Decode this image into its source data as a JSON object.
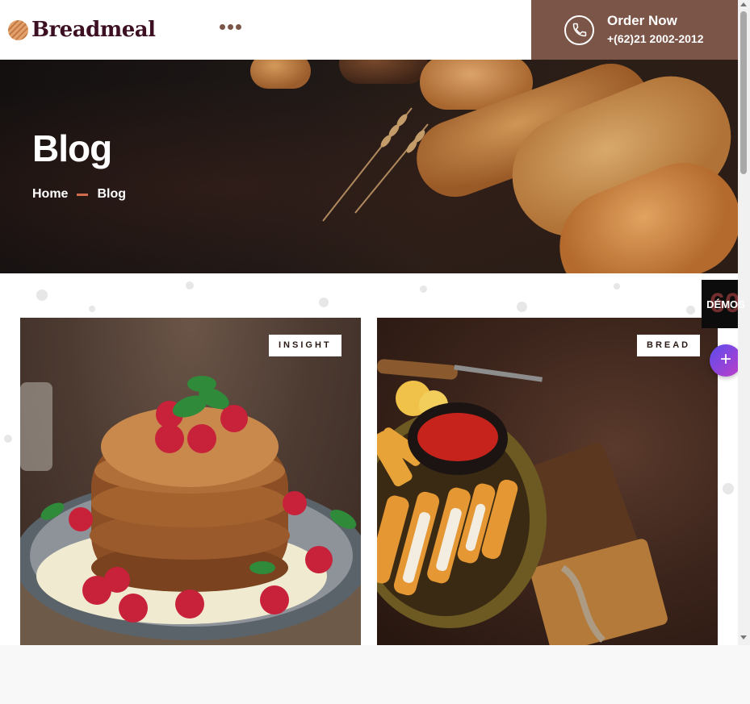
{
  "header": {
    "brand": "Breadmeal",
    "order_title": "Order Now",
    "order_phone": "+(62)21 2002-2012",
    "menu_icon": "more-dots-icon",
    "phone_icon": "phone-icon"
  },
  "hero": {
    "title": "Blog",
    "breadcrumb": [
      "Home",
      "Blog"
    ]
  },
  "posts": [
    {
      "category": "INSIGHT",
      "image": "pancakes-with-raspberries"
    },
    {
      "category": "BREAD",
      "image": "chicken-strips-with-fries"
    }
  ],
  "side": {
    "demos_label": "DÉMOS",
    "demos_ghost": "60",
    "plus_label": "+"
  },
  "colors": {
    "brand": "#3d0f22",
    "accent": "#7b5547",
    "breadcrumb_separator": "#d36b4f"
  }
}
